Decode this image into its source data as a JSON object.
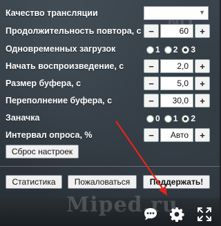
{
  "settings": {
    "quality_label": "Качество трансляции",
    "quality_value": "",
    "repeat_label": "Продолжительность повтора, с",
    "repeat_value": "60",
    "downloads_label": "Одновременных загрузок",
    "downloads_options": [
      "1",
      "2",
      "3"
    ],
    "downloads_selected": "3",
    "start_label": "Начать воспроизведение, с",
    "start_value": "2,0",
    "buffer_label": "Размер буфера, с",
    "buffer_value": "5,0",
    "overflow_label": "Переполнение буфера, с",
    "overflow_value": "30,0",
    "stash_label": "Заначка",
    "stash_options": [
      "0",
      "1",
      "2"
    ],
    "stash_selected": "2",
    "interval_label": "Интервал опроса, %",
    "interval_value": "Авто",
    "reset_label": "Сброс настроек",
    "minus": "−",
    "plus": "+"
  },
  "footer": {
    "stats_label": "Статистика",
    "complain_label": "Пожаловаться",
    "support_label": "Поддержать!"
  },
  "watermark": "Miped.ru",
  "icons": [
    "chat-icon",
    "gear-icon",
    "fullscreen-icon"
  ],
  "colors": {
    "arrow": "#e8231b",
    "panel_text": "#ffffff"
  }
}
